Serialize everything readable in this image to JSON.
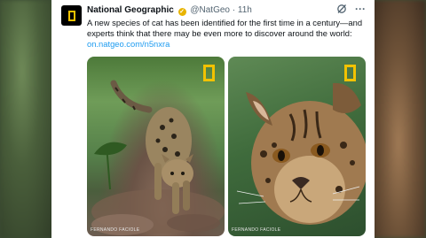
{
  "tweet": {
    "account_name": "National Geographic",
    "handle": "@NatGeo",
    "separator": "·",
    "time": "11h",
    "text": "A new species of cat has been identified for the first time in a century—and experts think that there may be even more to discover around the world:",
    "link": "on.natgeo.com/n5nxra"
  },
  "images": [
    {
      "alt": "Small spotted wild cat walking on forest floor",
      "credit": "FERNANDO FACIOLE"
    },
    {
      "alt": "Close-up portrait of a spotted wild cat",
      "credit": "FERNANDO FACIOLE"
    }
  ],
  "icons": {
    "avatar": "national-geographic-logo",
    "verified": "gold-checkmark",
    "grok": "grok-icon",
    "more": "more-options-icon"
  },
  "colors": {
    "brand_yellow": "#f2c200",
    "link_blue": "#1d9bf0",
    "text": "#0f1419",
    "muted": "#536471"
  }
}
